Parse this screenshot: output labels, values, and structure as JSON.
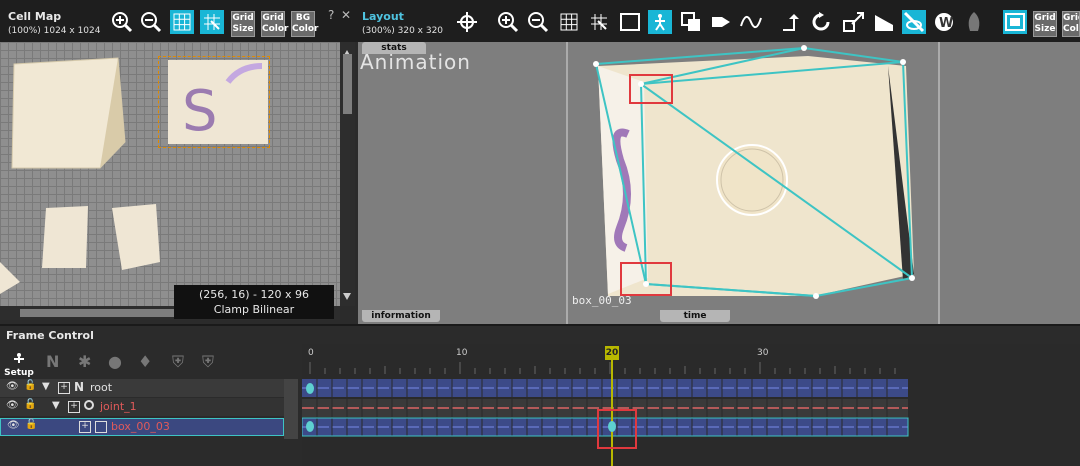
{
  "cell_map": {
    "title": "Cell Map",
    "subtitle": "(100%) 1024 x 1024",
    "buttons": {
      "grid_size": "Grid\nSize",
      "grid_color": "Grid\nColor",
      "bg_color": "BG\nColor"
    },
    "help": "?",
    "close": "✕",
    "info_line1": "(256, 16) - 120 x 96",
    "info_line2": "Clamp  Bilinear"
  },
  "layout": {
    "title": "Layout",
    "subtitle": "(300%) 320 x 320",
    "tabs": {
      "stats": "stats",
      "information": "information",
      "time": "time"
    },
    "watermark": "Animation",
    "selected_part": "box_00_03",
    "buttons": {
      "grid_size": "Grid\nSize",
      "grid_color": "Grid\nColor"
    }
  },
  "frame_control": {
    "title": "Frame Control",
    "setup_label": "Setup",
    "ruler": [
      "0",
      "10",
      "20",
      "30"
    ],
    "current_frame": "20",
    "layers": [
      {
        "name": "root",
        "color": "#e0e0e0"
      },
      {
        "name": "joint_1",
        "color": "#e05a5a"
      },
      {
        "name": "box_00_03",
        "color": "#e05a5a"
      }
    ]
  },
  "colors": {
    "accent": "#19b6d6",
    "selection_red": "#e0393e",
    "playhead": "#b8b800",
    "mesh": "#3ec4c4"
  }
}
